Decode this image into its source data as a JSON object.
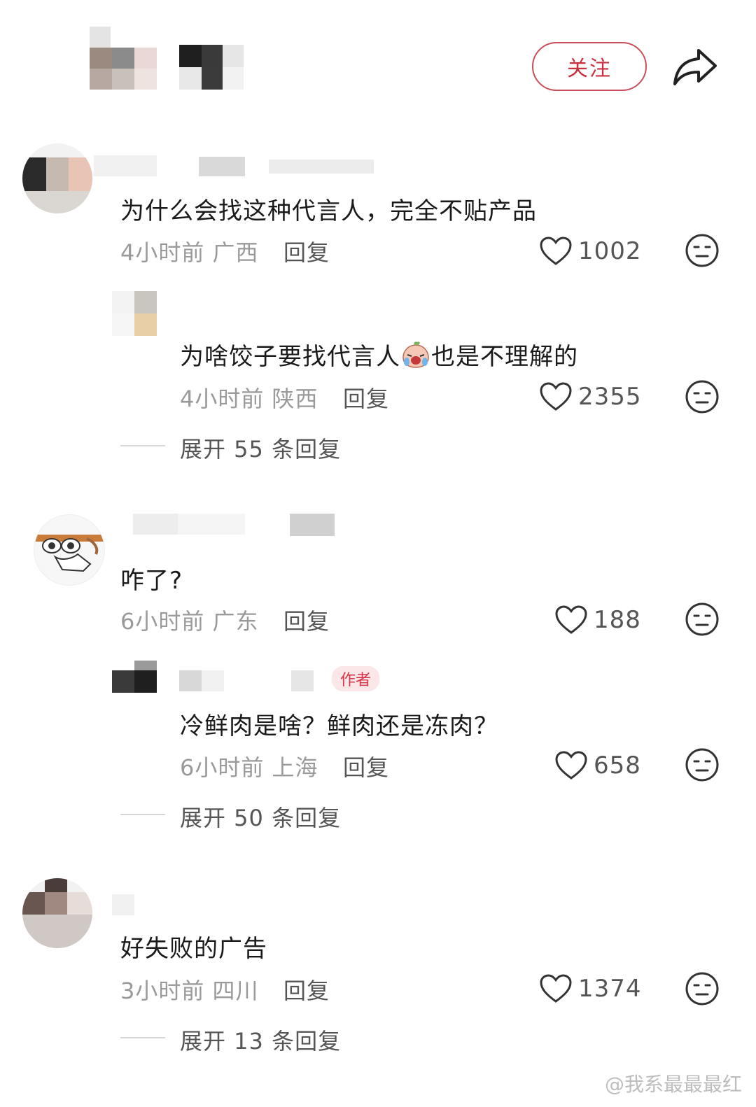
{
  "header": {
    "follow_label": "关注",
    "share_icon": "share-arrow-icon",
    "accent_color": "#c8303e"
  },
  "comments": [
    {
      "text": "为什么会找这种代言人，完全不贴产品",
      "time": "4小时前",
      "location": "广西",
      "reply_label": "回复",
      "likes": "1002",
      "replies": [
        {
          "text_before": "为啥饺子要找代言人",
          "emoji": "crying-face-emoji",
          "text_after": "也是不理解的",
          "time": "4小时前",
          "location": "陕西",
          "reply_label": "回复",
          "likes": "2355"
        }
      ],
      "expand_label": "展开 55 条回复"
    },
    {
      "text": "咋了?",
      "time": "6小时前",
      "location": "广东",
      "reply_label": "回复",
      "likes": "188",
      "replies": [
        {
          "author_tag": "作者",
          "text": "冷鲜肉是啥？鲜肉还是冻肉？",
          "time": "6小时前",
          "location": "上海",
          "reply_label": "回复",
          "likes": "658"
        }
      ],
      "expand_label": "展开 50 条回复"
    },
    {
      "text": "好失败的广告",
      "time": "3小时前",
      "location": "四川",
      "reply_label": "回复",
      "likes": "1374",
      "expand_label": "展开 13 条回复"
    }
  ],
  "watermark": "@我系最最最红"
}
